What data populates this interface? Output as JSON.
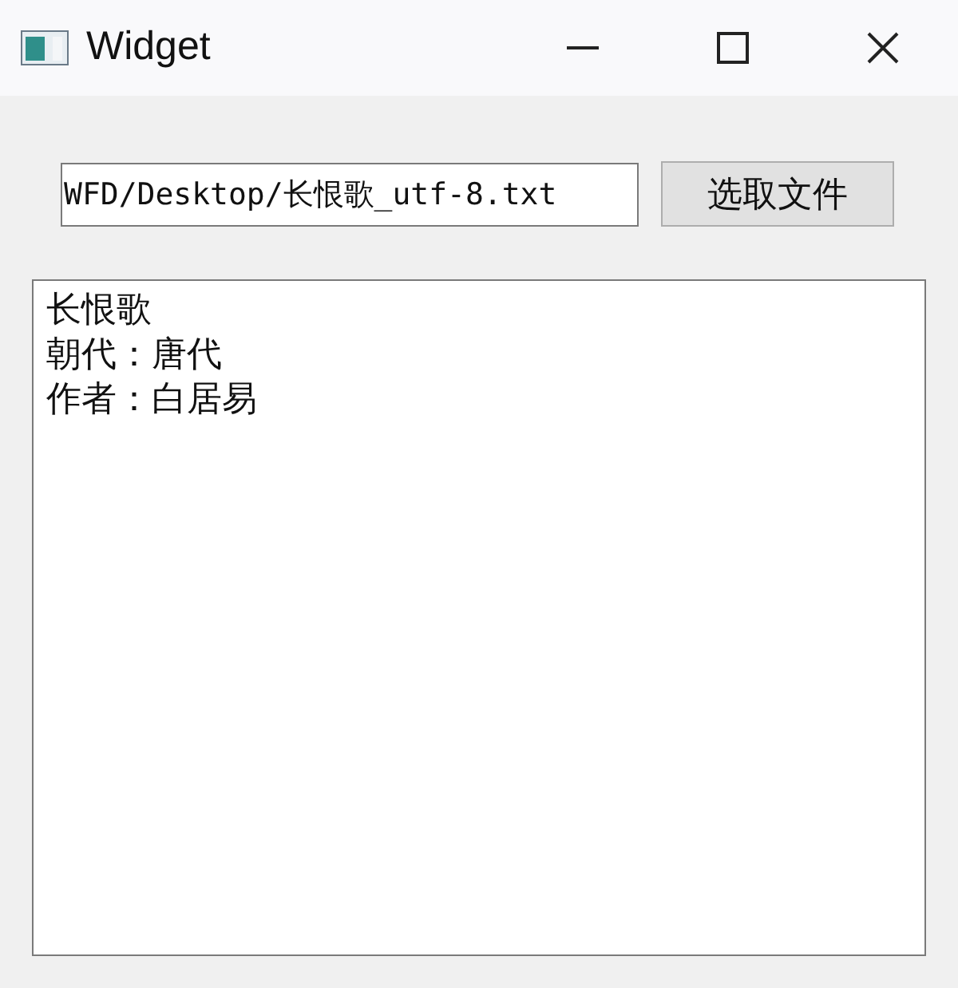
{
  "window": {
    "title": "Widget"
  },
  "file_path_field": {
    "value": "WFD/Desktop/长恨歌_utf-8.txt"
  },
  "choose_file_button": {
    "label": "选取文件"
  },
  "text_area": {
    "lines": [
      "长恨歌",
      "朝代：唐代",
      "作者：白居易"
    ]
  }
}
